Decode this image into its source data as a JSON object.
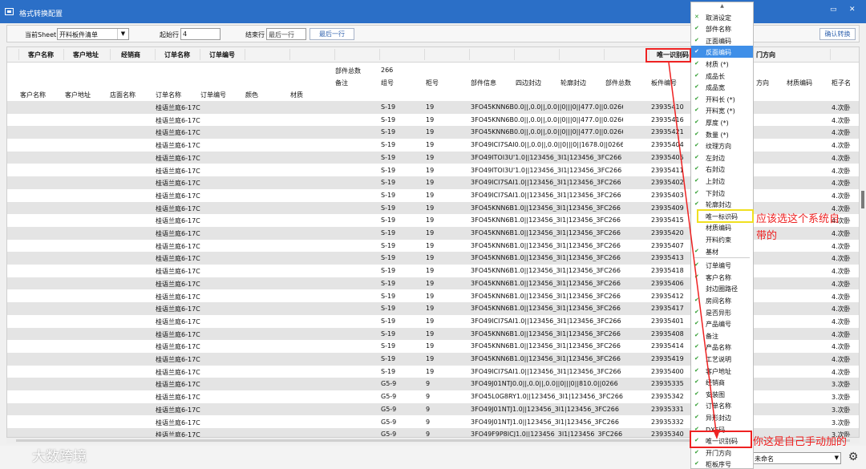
{
  "window": {
    "title": "格式转换配置",
    "btn_restore": "▭",
    "btn_close": "✕"
  },
  "toolbar": {
    "sheet_label": "当前Sheet",
    "sheet_value": "开料板件清单",
    "start_label": "起始行",
    "start_value": "4",
    "end_label": "结束行",
    "end_placeholder": "最后一行",
    "last_row_button": "最后一行",
    "confirm_button": "确认转换"
  },
  "grid": {
    "headers": [
      "客户名称",
      "客户地址",
      "经销商",
      "订单名称",
      "订单编号",
      "唯一识别码",
      "门方向"
    ],
    "info1": {
      "k": "部件总数",
      "v": "266"
    },
    "info2": [
      "备注",
      "组号",
      "柜号",
      "部件信息",
      "四边封边",
      "轮廓封边",
      "部件总数",
      "板件编号",
      "方向",
      "材质编码",
      "柜子名"
    ],
    "info3": [
      "客户名称",
      "客户地址",
      "店面名称",
      "订单名称",
      "订单编号",
      "颜色",
      "材质"
    ],
    "rows": [
      {
        "name": "桂语兰庭6-17C",
        "group": "S-19",
        "cab": "19",
        "info": "3FO45KNN6B0.0||,0.0||,0.0||0|||0||477.0||0.0266",
        "code": "23935410",
        "tail": "4.次卧"
      },
      {
        "name": "桂语兰庭6-17C",
        "group": "S-19",
        "cab": "19",
        "info": "3FO45KNN6B0.0||,0.0||,0.0||0|||0||477.0||0.0266",
        "code": "23935416",
        "tail": "4.次卧"
      },
      {
        "name": "桂语兰庭6-17C",
        "group": "S-19",
        "cab": "19",
        "info": "3FO45KNN6B0.0||,0.0||,0.0||0|||0||477.0||0.0266",
        "code": "23935421",
        "tail": "4.次卧"
      },
      {
        "name": "桂语兰庭6-17C",
        "group": "S-19",
        "cab": "19",
        "info": "3FO49ICI7SAI0.0||,0.0||,0.0||0|||0||1678.0||0266",
        "code": "23935404",
        "tail": "4.次卧"
      },
      {
        "name": "桂语兰庭6-17C",
        "group": "S-19",
        "cab": "19",
        "info": "3FO49ITOI3U'1.0||123456_3I1|123456_3FC266",
        "code": "23935405",
        "tail": "4.次卧"
      },
      {
        "name": "桂语兰庭6-17C",
        "group": "S-19",
        "cab": "19",
        "info": "3FO49ITOI3U'1.0||123456_3I1|123456_3FC266",
        "code": "23935411",
        "tail": "4.次卧"
      },
      {
        "name": "桂语兰庭6-17C",
        "group": "S-19",
        "cab": "19",
        "info": "3FO49ICI7SAI1.0||123456_3I1|123456_3FC266",
        "code": "23935402",
        "tail": "4.次卧"
      },
      {
        "name": "桂语兰庭6-17C",
        "group": "S-19",
        "cab": "19",
        "info": "3FO49ICI7SAI1.0||123456_3I1|123456_3FC266",
        "code": "23935403",
        "tail": "4.次卧"
      },
      {
        "name": "桂语兰庭6-17C",
        "group": "S-19",
        "cab": "19",
        "info": "3FO45KNN6B1.0||123456_3I1|123456_3FC266",
        "code": "23935409",
        "tail": "4.次卧"
      },
      {
        "name": "桂语兰庭6-17C",
        "group": "S-19",
        "cab": "19",
        "info": "3FO45KNN6B1.0||123456_3I1|123456_3FC266",
        "code": "23935415",
        "tail": "4.次卧"
      },
      {
        "name": "桂语兰庭6-17C",
        "group": "S-19",
        "cab": "19",
        "info": "3FO45KNN6B1.0||123456_3I1|123456_3FC266",
        "code": "23935420",
        "tail": "4.次卧"
      },
      {
        "name": "桂语兰庭6-17C",
        "group": "S-19",
        "cab": "19",
        "info": "3FO45KNN6B1.0||123456_3I1|123456_3FC266",
        "code": "23935407",
        "tail": "4.次卧"
      },
      {
        "name": "桂语兰庭6-17C",
        "group": "S-19",
        "cab": "19",
        "info": "3FO45KNN6B1.0||123456_3I1|123456_3FC266",
        "code": "23935413",
        "tail": "4.次卧"
      },
      {
        "name": "桂语兰庭6-17C",
        "group": "S-19",
        "cab": "19",
        "info": "3FO45KNN6B1.0||123456_3I1|123456_3FC266",
        "code": "23935418",
        "tail": "4.次卧"
      },
      {
        "name": "桂语兰庭6-17C",
        "group": "S-19",
        "cab": "19",
        "info": "3FO45KNN6B1.0||123456_3I1|123456_3FC266",
        "code": "23935406",
        "tail": "4.次卧"
      },
      {
        "name": "桂语兰庭6-17C",
        "group": "S-19",
        "cab": "19",
        "info": "3FO45KNN6B1.0||123456_3I1|123456_3FC266",
        "code": "23935412",
        "tail": "4.次卧"
      },
      {
        "name": "桂语兰庭6-17C",
        "group": "S-19",
        "cab": "19",
        "info": "3FO45KNN6B1.0||123456_3I1|123456_3FC266",
        "code": "23935417",
        "tail": "4.次卧"
      },
      {
        "name": "桂语兰庭6-17C",
        "group": "S-19",
        "cab": "19",
        "info": "3FO49ICI7SAI1.0||123456_3I1|123456_3FC266",
        "code": "23935401",
        "tail": "4.次卧"
      },
      {
        "name": "桂语兰庭6-17C",
        "group": "S-19",
        "cab": "19",
        "info": "3FO45KNN6B1.0||123456_3I1|123456_3FC266",
        "code": "23935408",
        "tail": "4.次卧"
      },
      {
        "name": "桂语兰庭6-17C",
        "group": "S-19",
        "cab": "19",
        "info": "3FO45KNN6B1.0||123456_3I1|123456_3FC266",
        "code": "23935414",
        "tail": "4.次卧"
      },
      {
        "name": "桂语兰庭6-17C",
        "group": "S-19",
        "cab": "19",
        "info": "3FO45KNN6B1.0||123456_3I1|123456_3FC266",
        "code": "23935419",
        "tail": "4.次卧"
      },
      {
        "name": "桂语兰庭6-17C",
        "group": "S-19",
        "cab": "19",
        "info": "3FO49ICI7SAI1.0||123456_3I1|123456_3FC266",
        "code": "23935400",
        "tail": "4.次卧"
      },
      {
        "name": "桂语兰庭6-17C",
        "group": "G5-9",
        "cab": "9",
        "info": "3FO49J01NTJ0.0||,0.0||,0.0||0|||0||810.0||0266",
        "code": "23935335",
        "tail": "3.次卧"
      },
      {
        "name": "桂语兰庭6-17C",
        "group": "G5-9",
        "cab": "9",
        "info": "3FO45L0G8RY1.0||123456_3I1|123456_3FC266",
        "code": "23935342",
        "tail": "3.次卧"
      },
      {
        "name": "桂语兰庭6-17C",
        "group": "G5-9",
        "cab": "9",
        "info": "3FO49J01NTJ1.0||123456_3I1|123456_3FC266",
        "code": "23935331",
        "tail": "3.次卧"
      },
      {
        "name": "桂语兰庭6-17C",
        "group": "G5-9",
        "cab": "9",
        "info": "3FO49J01NTJ1.0||123456_3I1|123456_3FC266",
        "code": "23935332",
        "tail": "3.次卧"
      },
      {
        "name": "桂语兰庭6-17C",
        "group": "G5-9",
        "cab": "9",
        "info": "3FO49F9P8ICJ1.0||123456_3I1|123456_3FC266",
        "code": "23935340",
        "tail": "3.次卧"
      }
    ]
  },
  "menu": {
    "items": [
      {
        "label": "取消设定",
        "mark": "✕",
        "x": true
      },
      {
        "label": "部件名称",
        "mark": "✔"
      },
      {
        "label": "正面编码",
        "mark": "✔"
      },
      {
        "label": "反面编码",
        "mark": "✔",
        "highlight": true
      },
      {
        "label": "材质 (*)",
        "mark": "✔"
      },
      {
        "label": "成品长",
        "mark": "✔"
      },
      {
        "label": "成品宽",
        "mark": "✔"
      },
      {
        "label": "开料长 (*)",
        "mark": "✔"
      },
      {
        "label": "开料宽 (*)",
        "mark": "✔"
      },
      {
        "label": "厚度 (*)",
        "mark": "✔"
      },
      {
        "label": "数量 (*)",
        "mark": "✔"
      },
      {
        "label": "纹理方向",
        "mark": "✔"
      },
      {
        "label": "左封边",
        "mark": "✔"
      },
      {
        "label": "右封边",
        "mark": "✔"
      },
      {
        "label": "上封边",
        "mark": "✔"
      },
      {
        "label": "下封边",
        "mark": "✔"
      },
      {
        "label": "轮廓封边",
        "mark": "✔"
      },
      {
        "label": "唯一标识码",
        "mark": ""
      },
      {
        "label": "材质编码",
        "mark": ""
      },
      {
        "label": "开料约束",
        "mark": ""
      },
      {
        "label": "基材",
        "mark": "✔"
      },
      {
        "label": "订单编号",
        "mark": "✔",
        "sep_before": true
      },
      {
        "label": "客户名称",
        "mark": "✔"
      },
      {
        "label": "封边圈路径",
        "mark": ""
      },
      {
        "label": "房间名称",
        "mark": "✔"
      },
      {
        "label": "是否异形",
        "mark": "✔"
      },
      {
        "label": "产品编号",
        "mark": "✔"
      },
      {
        "label": "备注",
        "mark": "✔"
      },
      {
        "label": "产品名称",
        "mark": "✔"
      },
      {
        "label": "工艺说明",
        "mark": "✔"
      },
      {
        "label": "客户地址",
        "mark": "✔"
      },
      {
        "label": "经销商",
        "mark": "✔"
      },
      {
        "label": "安装图",
        "mark": "✔"
      },
      {
        "label": "订单名称",
        "mark": "✔"
      },
      {
        "label": "异形封边",
        "mark": "✔"
      },
      {
        "label": "DXF码",
        "mark": "✔"
      },
      {
        "label": "唯一识别码",
        "mark": "✔"
      },
      {
        "label": "开门方向",
        "mark": "✔"
      },
      {
        "label": "柜板序号",
        "mark": "✔"
      }
    ]
  },
  "annotations": {
    "note1_line1": "应该选这个系统自",
    "note1_line2": "带的",
    "note2": "你这是自己手动加的"
  },
  "statusbar": {
    "select_value": "未命名",
    "watermark": "大数跨境"
  },
  "colors": {
    "titlebar": "#2b6fc7",
    "highlight": "#3f8fe8",
    "annotation": "#ee2222",
    "callout_box": "#f0e020"
  }
}
